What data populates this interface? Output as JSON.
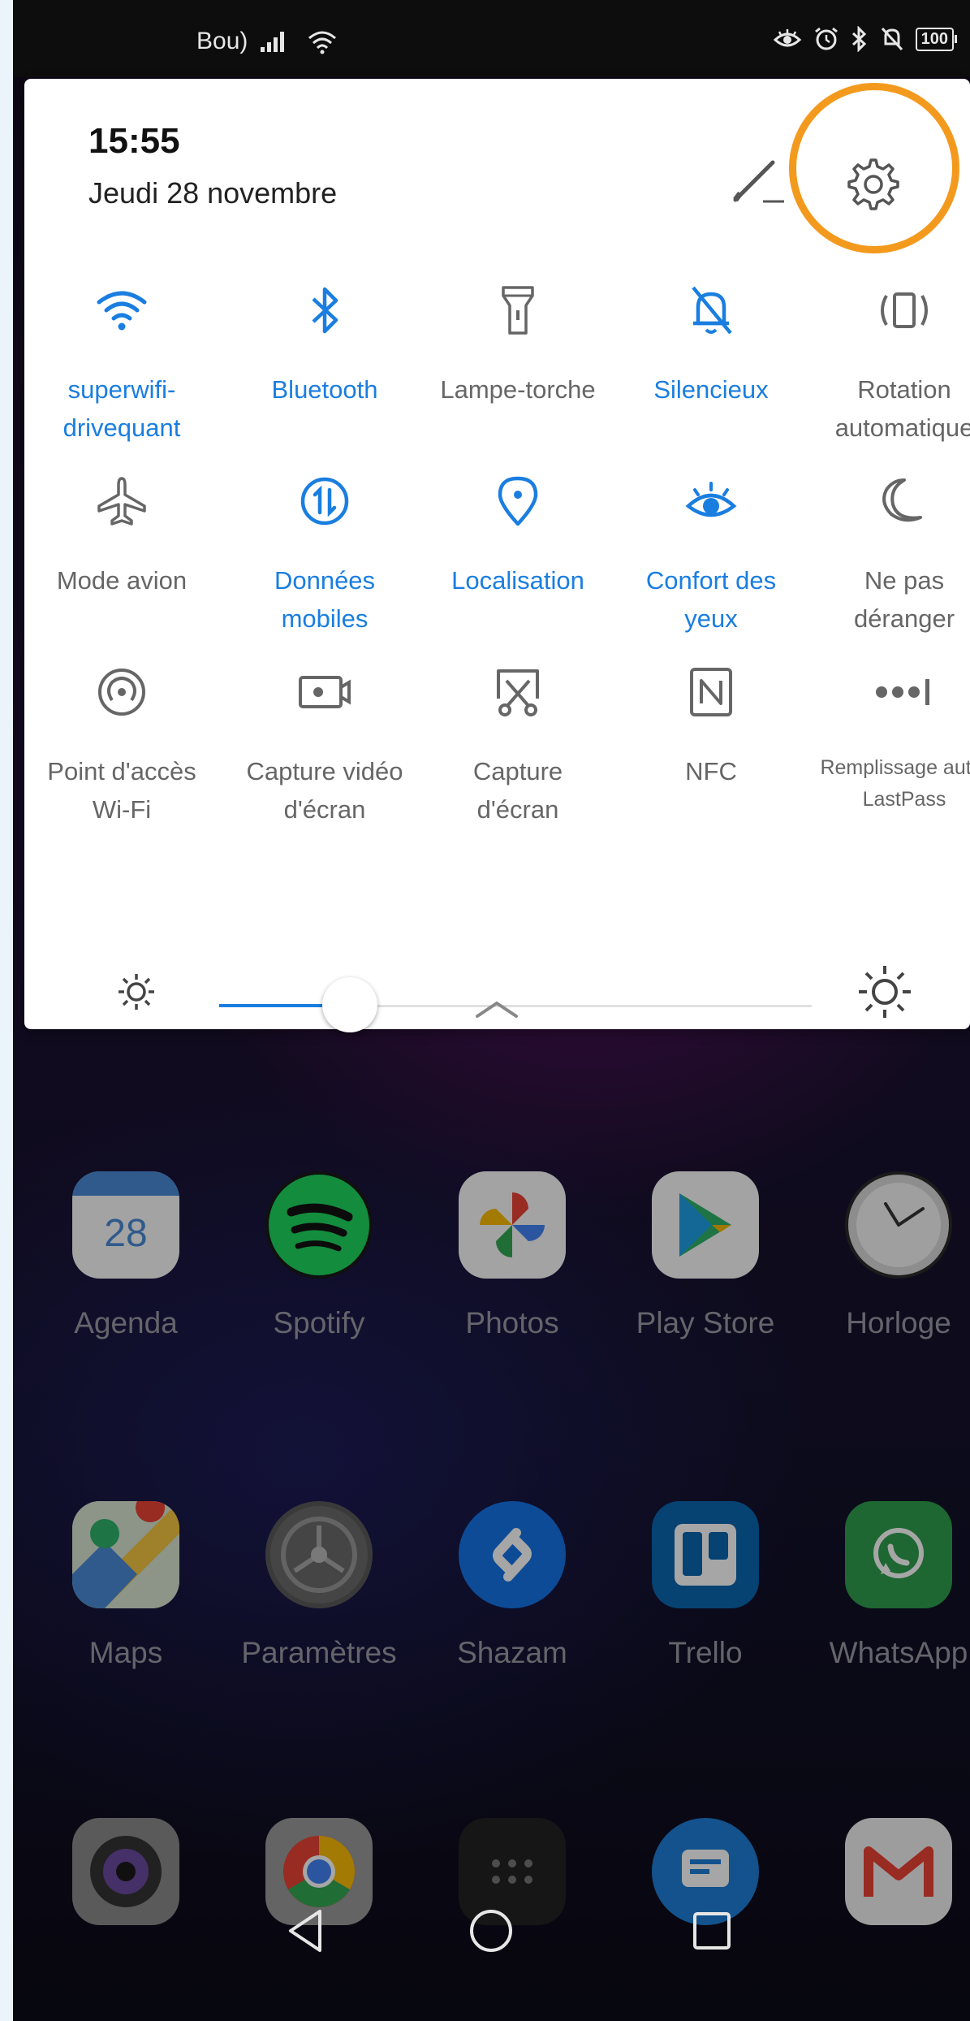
{
  "status_bar": {
    "carrier": "Bou)",
    "battery": "100"
  },
  "panel": {
    "time": "15:55",
    "date": "Jeudi 28 novembre",
    "tiles": [
      {
        "label": "superwifi-\ndrivequant",
        "icon": "wifi-icon",
        "active": true
      },
      {
        "label": "Bluetooth",
        "icon": "bluetooth-icon",
        "active": true
      },
      {
        "label": "Lampe-torche",
        "icon": "flashlight-icon",
        "active": false
      },
      {
        "label": "Silencieux",
        "icon": "bell-off-icon",
        "active": true
      },
      {
        "label": "Rotation\nautomatique",
        "icon": "rotation-icon",
        "active": false
      },
      {
        "label": "Mode avion",
        "icon": "airplane-icon",
        "active": false
      },
      {
        "label": "Données\nmobiles",
        "icon": "mobile-data-icon",
        "active": true
      },
      {
        "label": "Localisation",
        "icon": "location-pin-icon",
        "active": true
      },
      {
        "label": "Confort des\nyeux",
        "icon": "eye-comfort-icon",
        "active": true
      },
      {
        "label": "Ne pas\ndéranger",
        "icon": "moon-icon",
        "active": false
      },
      {
        "label": "Point d'accès\nWi-Fi",
        "icon": "hotspot-icon",
        "active": false
      },
      {
        "label": "Capture vidéo\nd'écran",
        "icon": "screen-record-icon",
        "active": false
      },
      {
        "label": "Capture\nd'écran",
        "icon": "screenshot-icon",
        "active": false
      },
      {
        "label": "NFC",
        "icon": "nfc-icon",
        "active": false
      },
      {
        "label": "Remplissage auto.\nLastPass",
        "icon": "autofill-icon",
        "active": false
      }
    ],
    "brightness_fraction": 0.22,
    "accent_color": "#1a7ee0",
    "highlight_color": "#f39a1e"
  },
  "home": {
    "apps": [
      {
        "label": "Agenda",
        "icon": "calendar-icon",
        "badge": "28"
      },
      {
        "label": "Spotify",
        "icon": "spotify-icon"
      },
      {
        "label": "Photos",
        "icon": "photos-icon"
      },
      {
        "label": "Play Store",
        "icon": "play-store-icon"
      },
      {
        "label": "Horloge",
        "icon": "clock-icon"
      },
      {
        "label": "Maps",
        "icon": "maps-icon"
      },
      {
        "label": "Paramètres",
        "icon": "settings-app-icon"
      },
      {
        "label": "Shazam",
        "icon": "shazam-icon"
      },
      {
        "label": "Trello",
        "icon": "trello-icon"
      },
      {
        "label": "WhatsApp",
        "icon": "whatsapp-icon"
      },
      {
        "label": "",
        "icon": "camera-icon"
      },
      {
        "label": "",
        "icon": "chrome-icon"
      },
      {
        "label": "",
        "icon": "app-drawer-icon"
      },
      {
        "label": "",
        "icon": "messages-icon"
      },
      {
        "label": "",
        "icon": "gmail-icon"
      }
    ]
  },
  "nav": {
    "back": "back-icon",
    "home": "home-icon",
    "recents": "recents-icon"
  }
}
